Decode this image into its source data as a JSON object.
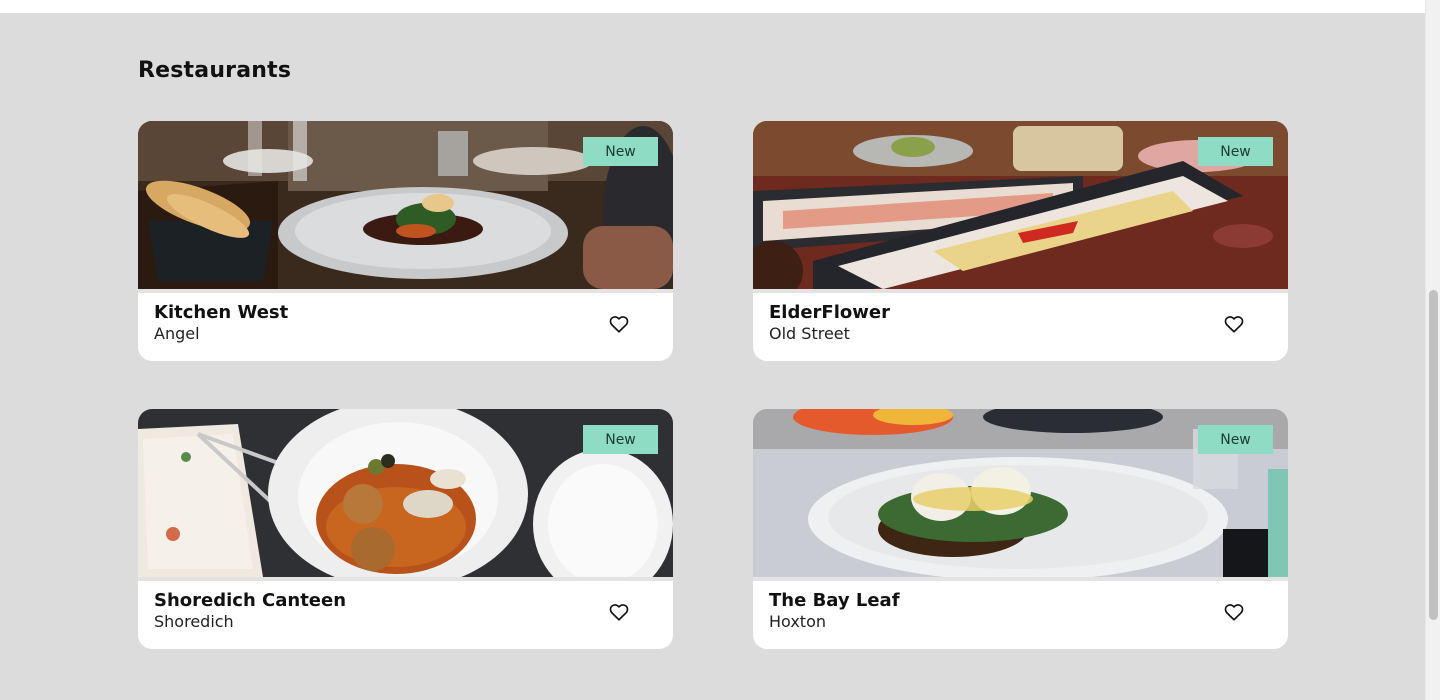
{
  "page": {
    "title": "Restaurants"
  },
  "restaurants": [
    {
      "name": "Kitchen West",
      "area": "Angel",
      "badge": "New",
      "favorite_icon": "heart-outline-icon"
    },
    {
      "name": "ElderFlower",
      "area": "Old Street",
      "badge": "New",
      "favorite_icon": "heart-outline-icon"
    },
    {
      "name": "Shoredich Canteen",
      "area": "Shoredich",
      "badge": "New",
      "favorite_icon": "heart-outline-icon"
    },
    {
      "name": "The Bay Leaf",
      "area": "Hoxton",
      "badge": "New",
      "favorite_icon": "heart-outline-icon"
    }
  ],
  "colors": {
    "background": "#dcdcdc",
    "card": "#ffffff",
    "badge": "#8fdcc4"
  }
}
